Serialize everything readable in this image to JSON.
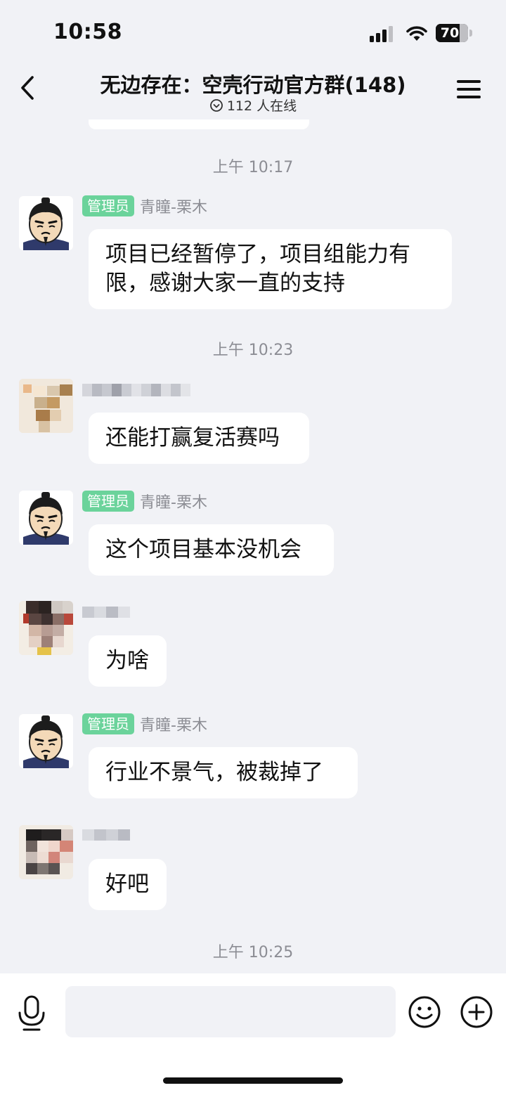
{
  "status_bar": {
    "time": "10:58",
    "battery": "70"
  },
  "header": {
    "title": "无边存在：空壳行动官方群(148)",
    "online": "112 人在线"
  },
  "messages": [
    {
      "type": "timestamp",
      "text": "上午 10:17"
    },
    {
      "type": "message",
      "admin_tag": "管理员",
      "sender": "青瞳-栗木",
      "text_lines": [
        "项目已经暂停了，项目组能力有",
        "限，感谢大家一直的支持"
      ]
    },
    {
      "type": "timestamp",
      "text": "上午 10:23"
    },
    {
      "type": "message",
      "sender_blurred": true,
      "text_lines": [
        "还能打赢复活赛吗"
      ]
    },
    {
      "type": "message",
      "admin_tag": "管理员",
      "sender": "青瞳-栗木",
      "text_lines": [
        "这个项目基本没机会"
      ]
    },
    {
      "type": "message",
      "sender_blurred": true,
      "text_lines": [
        "为啥"
      ]
    },
    {
      "type": "message",
      "admin_tag": "管理员",
      "sender": "青瞳-栗木",
      "text_lines": [
        "行业不景气，被裁掉了"
      ]
    },
    {
      "type": "message",
      "sender_blurred": true,
      "text_lines": [
        "好吧"
      ]
    },
    {
      "type": "timestamp",
      "text": "上午 10:25"
    }
  ],
  "input_bar": {
    "placeholder": ""
  },
  "colors": {
    "admin_tag": "#6bd39b",
    "background": "#f1f2f6",
    "bubble": "#ffffff"
  }
}
